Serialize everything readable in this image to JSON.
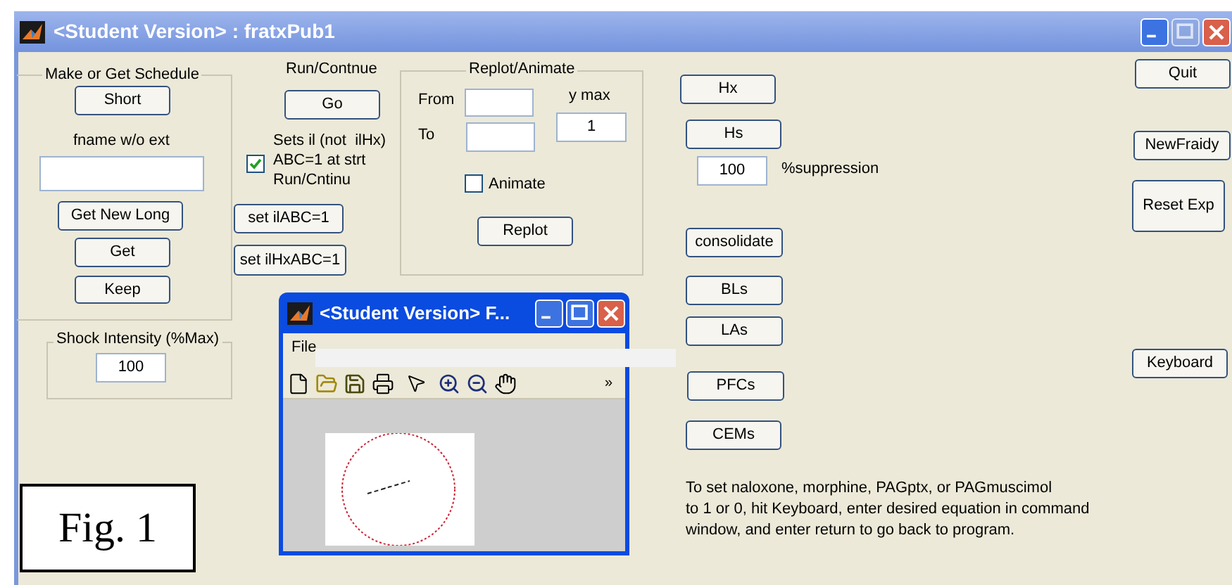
{
  "window": {
    "title": "<Student Version> : fratxPub1",
    "controls": [
      {
        "kind": "minimize",
        "disabled": false
      },
      {
        "kind": "maximize",
        "disabled": true
      },
      {
        "kind": "close",
        "disabled": false
      }
    ]
  },
  "schedule_panel": {
    "title": "Make or Get Schedule",
    "short_button": "Short",
    "fname_label": "fname w/o ext",
    "buttons": [
      "Get New Long",
      "Get",
      "Keep"
    ]
  },
  "run_section": {
    "title": "Run/Contnue",
    "go_button": "Go",
    "reset_checkbox": {
      "label_lines": [
        "Sets il (not  ilHx)",
        "ABC=1 at strt",
        "Run/Cntinu"
      ],
      "checked": true
    },
    "buttons": [
      "set ilABC=1",
      "set ilHxABC=1"
    ]
  },
  "replot_panel": {
    "title": "Replot/Animate",
    "from_label": "From",
    "to_label": "To",
    "ymax_label": "y max",
    "ymax_value": "1",
    "animate": {
      "label": "Animate",
      "checked": false
    },
    "replot_button": "Replot"
  },
  "shock_panel": {
    "title": "Shock Intensity (%Max)",
    "value": "100"
  },
  "hx_button": "Hx",
  "hs_button": "Hs",
  "suppression": {
    "value": "100",
    "label": "%suppression"
  },
  "region_buttons": [
    "consolidate",
    "BLs",
    "LAs",
    "PFCs",
    "CEMs"
  ],
  "right_buttons": [
    "Quit",
    "NewFraidy",
    "Reset Exp",
    "Keyboard"
  ],
  "instructions": [
    "To set naloxone, morphine, PAGptx, or PAGmuscimol",
    "to 1 or 0, hit Keyboard, enter desired equation in command",
    "window, and enter return to go back to program."
  ],
  "figure_window": {
    "title": "<Student Version> F...",
    "menu": [
      "File"
    ],
    "more_glyph": "»"
  },
  "caption": "Fig. 1"
}
